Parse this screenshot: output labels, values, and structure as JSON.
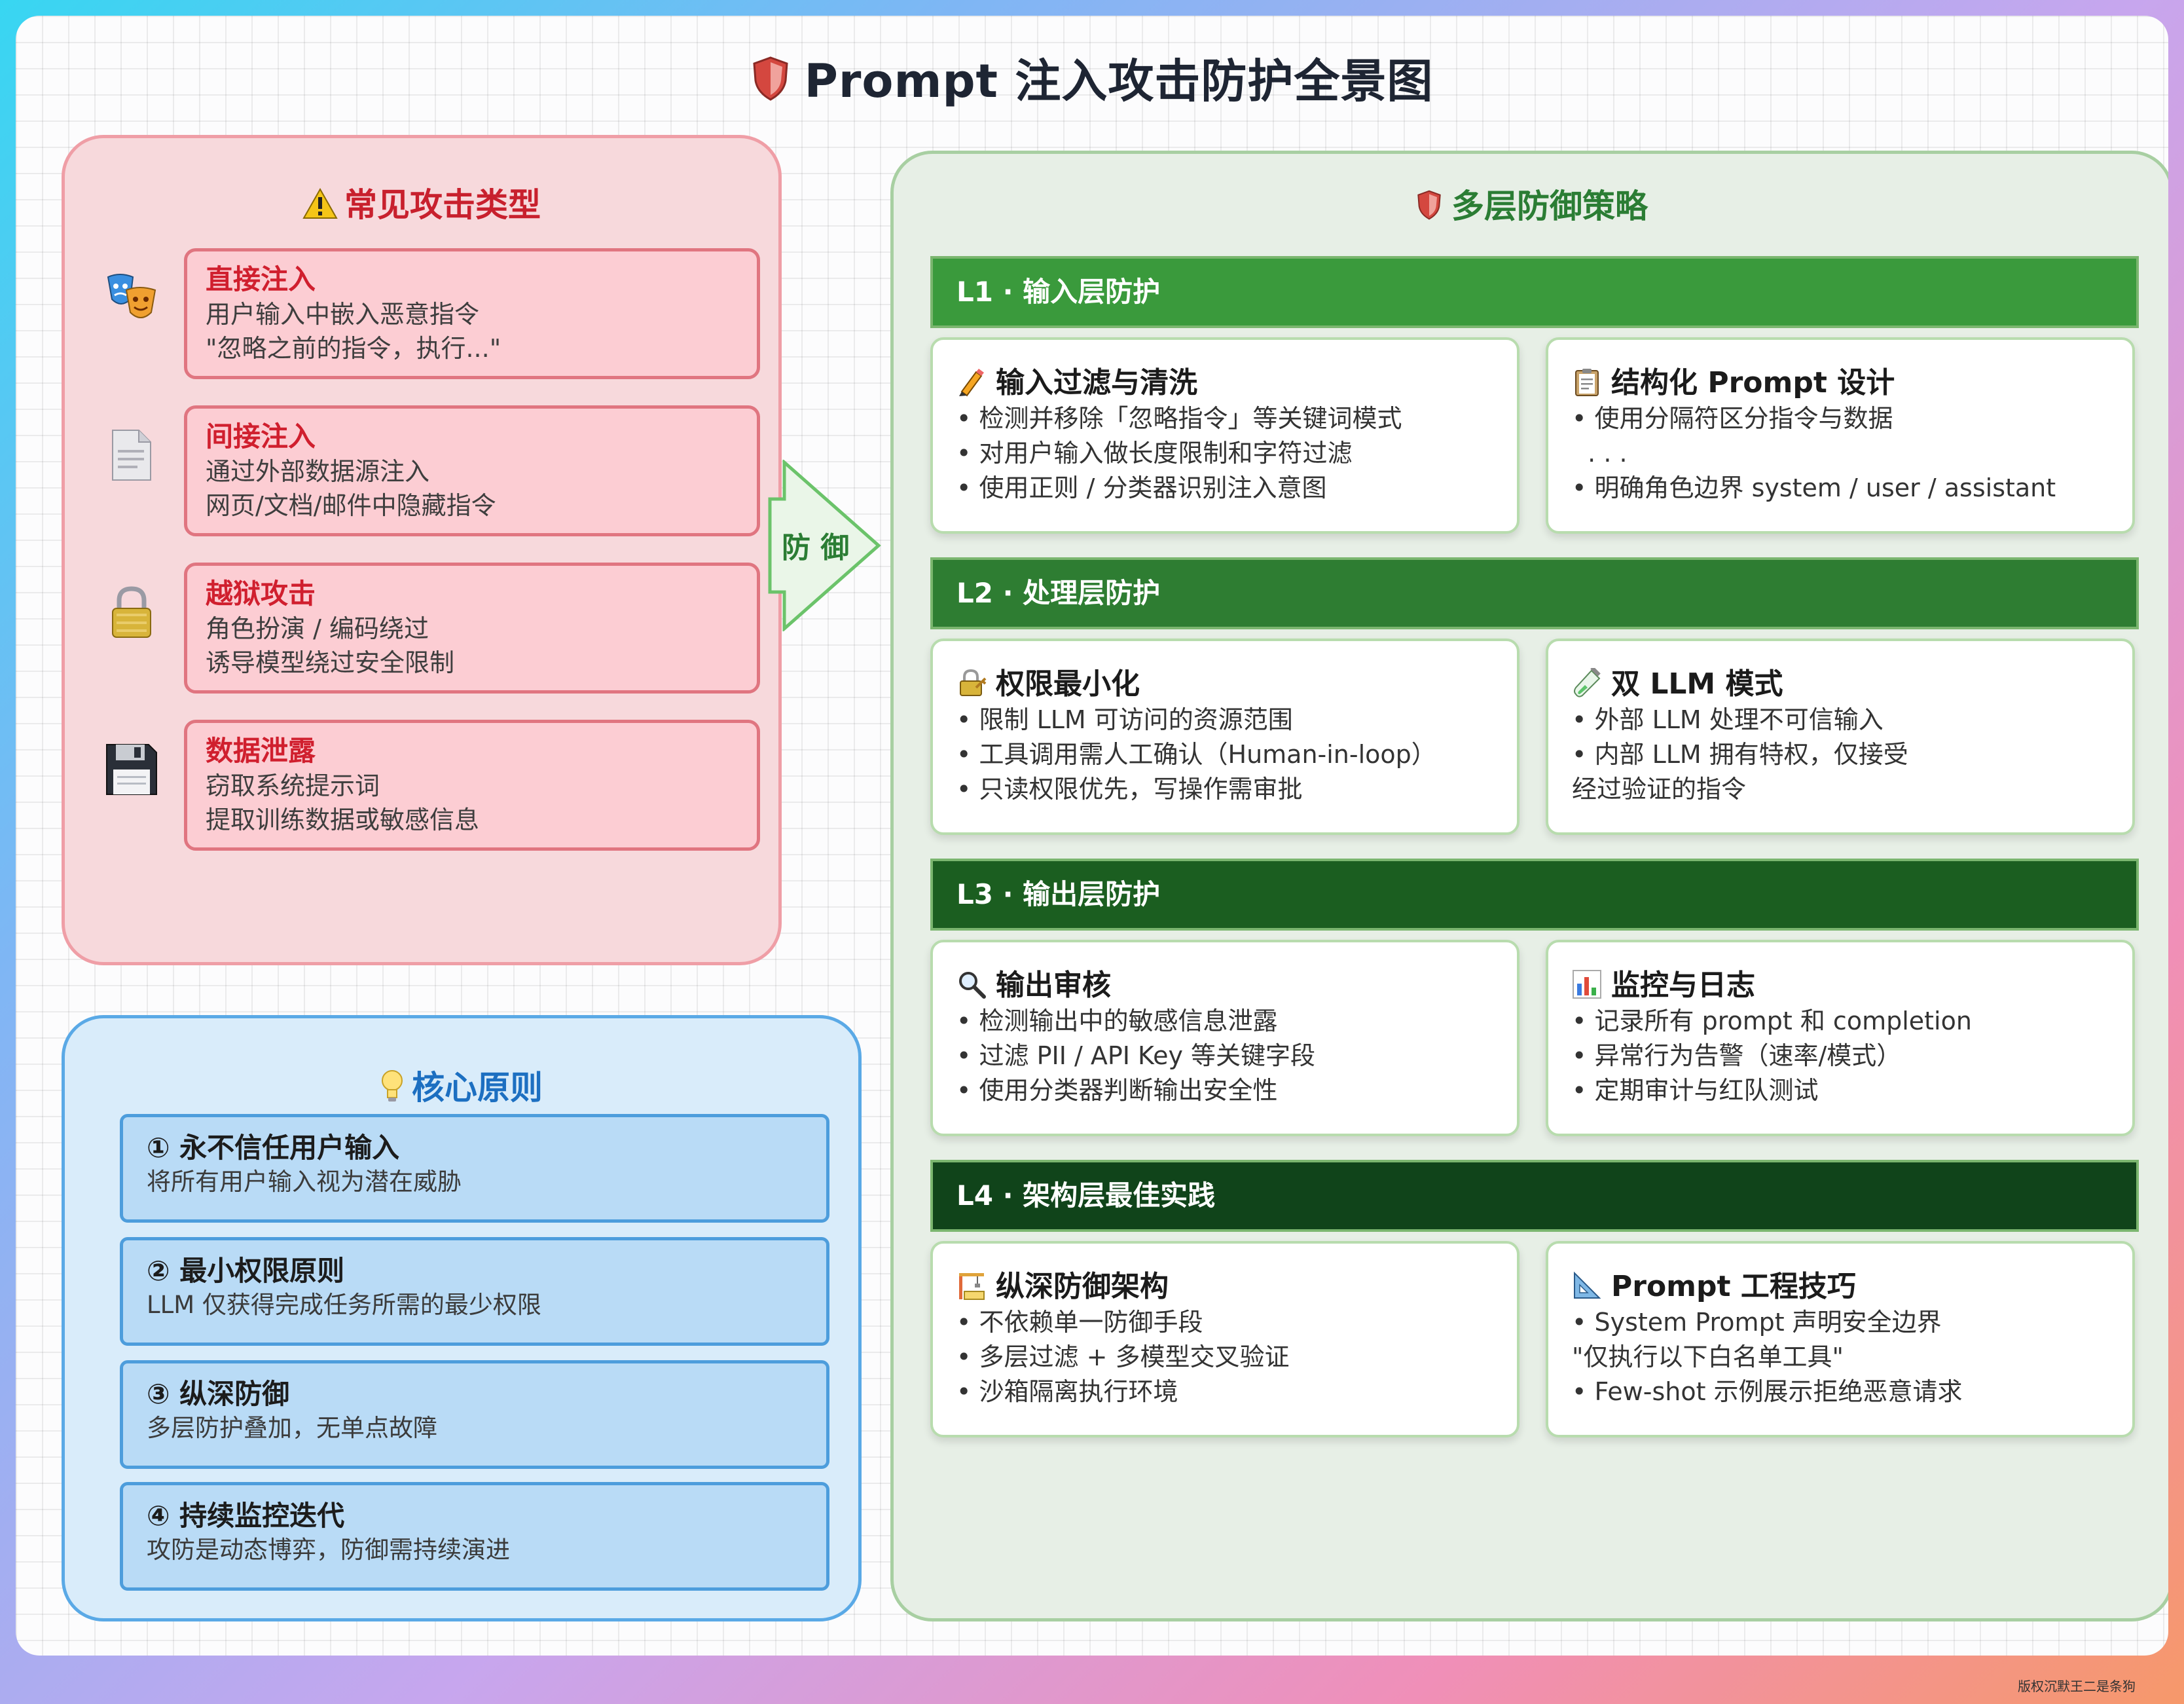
{
  "title": "Prompt 注入攻击防护全景图",
  "watermark": "版权沉默王二是条狗",
  "arrow_label": "防 御",
  "attacks": {
    "title": "常见攻击类型",
    "items": [
      {
        "icon": "theater-masks-icon",
        "title": "直接注入",
        "lines": [
          "用户输入中嵌入恶意指令",
          "\"忽略之前的指令，执行...\""
        ]
      },
      {
        "icon": "document-icon",
        "title": "间接注入",
        "lines": [
          "通过外部数据源注入",
          "网页/文档/邮件中隐藏指令"
        ]
      },
      {
        "icon": "padlock-icon",
        "title": "越狱攻击",
        "lines": [
          "角色扮演 / 编码绕过",
          "诱导模型绕过安全限制"
        ]
      },
      {
        "icon": "floppy-disk-icon",
        "title": "数据泄露",
        "lines": [
          "窃取系统提示词",
          "提取训练数据或敏感信息"
        ]
      }
    ]
  },
  "principles": {
    "title": "核心原则",
    "items": [
      {
        "title": "① 永不信任用户输入",
        "desc": "将所有用户输入视为潜在威胁"
      },
      {
        "title": "② 最小权限原则",
        "desc": "LLM 仅获得完成任务所需的最少权限"
      },
      {
        "title": "③ 纵深防御",
        "desc": "多层防护叠加，无单点故障"
      },
      {
        "title": "④ 持续监控迭代",
        "desc": "攻防是动态博弈，防御需持续演进"
      }
    ]
  },
  "defense": {
    "title": "多层防御策略",
    "layers": [
      {
        "header": "L1 · 输入层防护",
        "color": "#3a9a3c",
        "cards": [
          {
            "icon": "pencil-icon",
            "title": "输入过滤与清洗",
            "lines": [
              "• 检测并移除「忽略指令」等关键词模式",
              "• 对用户输入做长度限制和字符过滤",
              "• 使用正则 / 分类器识别注入意图"
            ]
          },
          {
            "icon": "clipboard-icon",
            "title": "结构化 Prompt 设计",
            "lines": [
              "• 使用分隔符区分指令与数据",
              "  . . .",
              "• 明确角色边界 system / user / assistant"
            ]
          }
        ]
      },
      {
        "header": "L2 · 处理层防护",
        "color": "#2e7d32",
        "cards": [
          {
            "icon": "lock-key-icon",
            "title": "权限最小化",
            "lines": [
              "• 限制 LLM 可访问的资源范围",
              "• 工具调用需人工确认（Human-in-loop）",
              "• 只读权限优先，写操作需审批"
            ]
          },
          {
            "icon": "test-tube-icon",
            "title": "双 LLM 模式",
            "lines": [
              "• 外部 LLM 处理不可信输入",
              "• 内部 LLM 拥有特权，仅接受",
              "经过验证的指令"
            ]
          }
        ]
      },
      {
        "header": "L3 · 输出层防护",
        "color": "#1b5e20",
        "cards": [
          {
            "icon": "magnifier-icon",
            "title": "输出审核",
            "lines": [
              "• 检测输出中的敏感信息泄露",
              "• 过滤 PII / API Key 等关键字段",
              "• 使用分类器判断输出安全性"
            ]
          },
          {
            "icon": "bar-chart-icon",
            "title": "监控与日志",
            "lines": [
              "• 记录所有 prompt 和 completion",
              "• 异常行为告警（速率/模式）",
              "• 定期审计与红队测试"
            ]
          }
        ]
      },
      {
        "header": "L4 · 架构层最佳实践",
        "color": "#10441a",
        "cards": [
          {
            "icon": "construction-icon",
            "title": "纵深防御架构",
            "lines": [
              "• 不依赖单一防御手段",
              "• 多层过滤 + 多模型交叉验证",
              "• 沙箱隔离执行环境"
            ]
          },
          {
            "icon": "triangle-ruler-icon",
            "title": "Prompt 工程技巧",
            "lines": [
              "• System Prompt 声明安全边界",
              "\"仅执行以下白名单工具\"",
              "• Few-shot 示例展示拒绝恶意请求"
            ]
          }
        ]
      }
    ]
  },
  "colors": {
    "attack": "#d01f2e",
    "principle": "#1c6fc1",
    "defense": "#2b7d34"
  }
}
